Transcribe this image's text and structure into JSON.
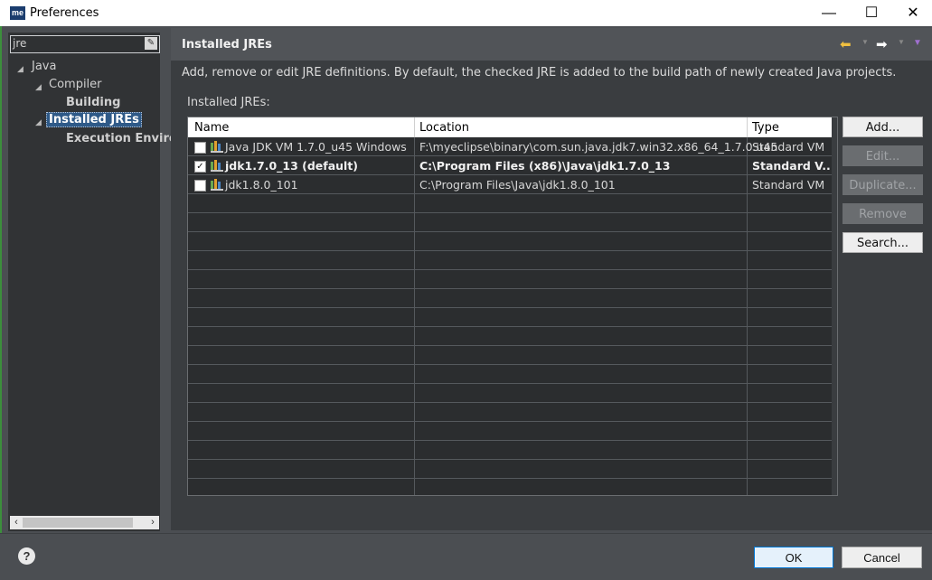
{
  "window": {
    "title": "Preferences",
    "app_icon": "me",
    "minimize": "—",
    "maximize": "☐",
    "close": "✕"
  },
  "filter": {
    "value": "jre",
    "clear_icon": "eraser-icon"
  },
  "tree": [
    {
      "label": "Java",
      "level": 0,
      "expanded": true
    },
    {
      "label": "Compiler",
      "level": 1,
      "expanded": true
    },
    {
      "label": "Building",
      "level": 2,
      "bold": true
    },
    {
      "label": "Installed JREs",
      "level": 1,
      "selected": true
    },
    {
      "label": "Execution Enviro",
      "level": 2,
      "bold": true
    }
  ],
  "page": {
    "title": "Installed JREs",
    "description": "Add, remove or edit JRE definitions. By default, the checked JRE is added to the build path of newly created Java projects.",
    "list_label": "Installed JREs:"
  },
  "table": {
    "headers": [
      "Name",
      "Location",
      "Type"
    ],
    "rows": [
      {
        "checked": false,
        "bold": false,
        "name": "Java JDK VM 1.7.0_u45 Windows",
        "location": "F:\\myeclipse\\binary\\com.sun.java.jdk7.win32.x86_64_1.7.0.u45",
        "type": "Standard VM"
      },
      {
        "checked": true,
        "bold": true,
        "name": "jdk1.7.0_13 (default)",
        "location": "C:\\Program Files (x86)\\Java\\jdk1.7.0_13",
        "type": "Standard V..."
      },
      {
        "checked": false,
        "bold": false,
        "name": "jdk1.8.0_101",
        "location": "C:\\Program Files\\Java\\jdk1.8.0_101",
        "type": "Standard VM"
      }
    ]
  },
  "buttons": {
    "add": "Add...",
    "edit": "Edit...",
    "duplicate": "Duplicate...",
    "remove": "Remove",
    "search": "Search..."
  },
  "footer": {
    "help": "?",
    "ok": "OK",
    "cancel": "Cancel"
  },
  "colors": {
    "accent": "#0078d7",
    "selection": "#2f5a88",
    "back_arrow": "#f0c040"
  }
}
